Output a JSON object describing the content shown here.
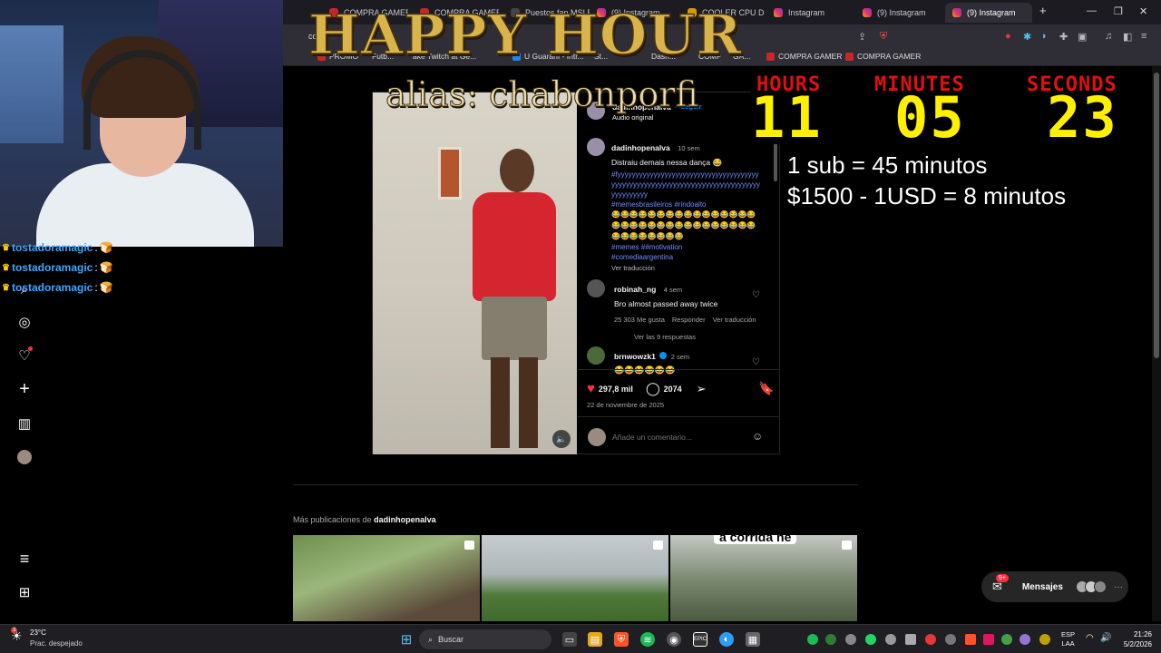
{
  "browser": {
    "tabs": [
      {
        "label": "COMPRA GAMER"
      },
      {
        "label": "COMPRA GAMER"
      },
      {
        "label": "Puestos fan MSI R"
      },
      {
        "label": "(9) Instagram"
      },
      {
        "label": "COOLER CPU D"
      },
      {
        "label": "Instagram"
      },
      {
        "label": "(9) Instagram"
      },
      {
        "label": "(9) Instagram"
      }
    ],
    "active_tab_close": "×",
    "new_tab": "+",
    "address_partial": "co",
    "bookmarks": [
      "PROMO",
      "Futb...",
      "ake Twitch at Ge...",
      "U Guaraní - Intr...",
      "St...",
      "Dash...",
      "COMP",
      "GA...",
      "COMPRA GAMER",
      "COMPRA GAMER"
    ]
  },
  "overlay": {
    "title": "HAPPY HOUR",
    "alias": "alias: chabonporfi",
    "timer": {
      "hours_label": "HOURS",
      "hours": "11",
      "minutes_label": "MINUTES",
      "minutes": "05",
      "seconds_label": "SECONDS",
      "seconds": "23"
    },
    "rule1": "1 sub = 45 minutos",
    "rule2": "$1500 - 1USD = 8 minutos"
  },
  "chat": [
    {
      "user": "tostadoramagic",
      "msg": ":"
    },
    {
      "user": "tostadoramagic",
      "msg": ":"
    },
    {
      "user": "tostadoramagic",
      "msg": ":"
    }
  ],
  "post": {
    "author": "dadinhopenalva",
    "follow": "Seguir",
    "audio": "Audio original",
    "caption_user": "dadinhopenalva",
    "caption_time": "10 sem",
    "caption_text": "Distraiu demais nessa dança 😂",
    "hashtags1": "#fyyyyyyyyyyyyyyyyyyyyyyyyyyyyyyyyyyyyyyyyyyyyyyyyyyyyyyyyyyyyyyyyyyyyyyyyyyyyyyyyyyyyyyyyyy",
    "hashtags2": "#memesbrasileiros #rindoalto",
    "emojis": "😂😂😂😂😂😂😂😂😂😂😂😂😂😂😂😂😂😂😂😂😂😂😂😂😂😂😂😂😂😂😂😂😂😂😂😂😂😂😂😂",
    "hashtags3": "#memes ##motivation",
    "hashtags4": "#comediaargentina",
    "see_translation": "Ver traducción",
    "comments": [
      {
        "user": "robinah_ng",
        "time": "4 sem",
        "text": "Bro almost passed away twice",
        "likes": "25 303 Me gusta",
        "reply": "Responder",
        "translate": "Ver traducción",
        "replies": "Ver las 9 respuestas"
      },
      {
        "user": "brnwowzk1",
        "time": "2 sem",
        "text": "😂😂😂😂😂😂"
      }
    ],
    "likes": "297,8 mil",
    "comments_count": "2074",
    "date": "22 de noviembre de 2025",
    "add_comment_placeholder": "Añade un comentario..."
  },
  "more_posts": {
    "prefix": "Más publicaciones de",
    "user": "dadinhopenalva",
    "thumb3_text": "a corrida ne"
  },
  "messages": {
    "badge": "9+",
    "label": "Mensajes"
  },
  "taskbar": {
    "weather_temp": "23°C",
    "weather_desc": "Prac. despejado",
    "weather_badge": "3",
    "search": "Buscar",
    "lang1": "ESP",
    "lang2": "LAA",
    "time": "21:26",
    "date": "5/2/2026"
  }
}
